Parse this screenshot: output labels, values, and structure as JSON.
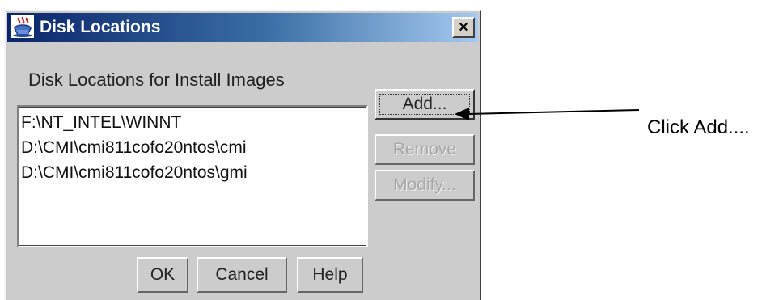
{
  "window": {
    "title": "Disk Locations",
    "close_label": "×"
  },
  "section_label": "Disk Locations for Install Images",
  "list": {
    "items": [
      "F:\\NT_INTEL\\WINNT",
      "D:\\CMI\\cmi811cofo20ntos\\cmi",
      "D:\\CMI\\cmi811cofo20ntos\\gmi"
    ]
  },
  "buttons": {
    "add": "Add...",
    "remove": "Remove",
    "modify": "Modify...",
    "ok": "OK",
    "cancel": "Cancel",
    "help": "Help"
  },
  "annotation": {
    "text": "Click Add...."
  },
  "colors": {
    "titlebar_start": "#0a246a",
    "titlebar_end": "#a6caf0",
    "dialog_bg": "#cccccc",
    "disabled_text": "#a8a8a8"
  },
  "icons": {
    "app": "java-coffee-cup-icon",
    "close": "close-icon",
    "annotation": "arrow-left-icon"
  }
}
